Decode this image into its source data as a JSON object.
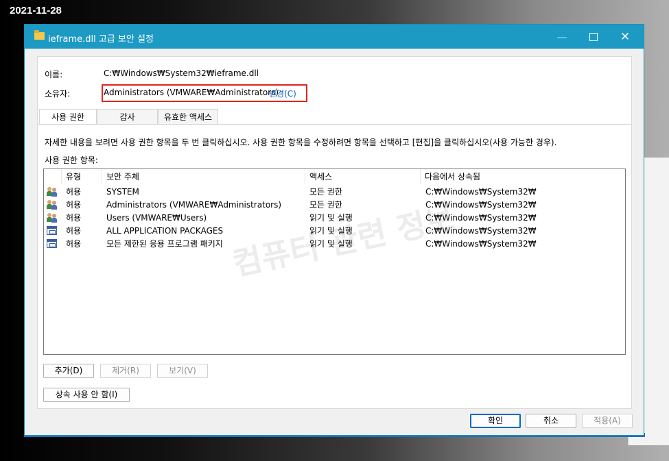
{
  "date": "2021-11-28",
  "window": {
    "title": "ieframe.dll 고급 보안 설정",
    "minimize_label": "—",
    "close_label": "✕"
  },
  "fields": {
    "name_label": "이름:",
    "name_value": "C:₩Windows₩System32₩ieframe.dll",
    "owner_label": "소유자:",
    "owner_value": "Administrators (VMWARE₩Administrators)",
    "owner_change": "변경(C)"
  },
  "tabs": [
    "사용 권한",
    "감사",
    "유효한 액세스"
  ],
  "description": "자세한 내용을 보려면 사용 권한 항목을 두 번 클릭하십시오. 사용 권한 항목을 수정하려면 항목을 선택하고 [편집]을 클릭하십시오(사용 가능한 경우).",
  "list_label": "사용 권한 항목:",
  "columns": [
    "유형",
    "보안 주체",
    "액세스",
    "다음에서 상속됨"
  ],
  "rows": [
    {
      "icon": "users-icon",
      "type": "허용",
      "principal": "SYSTEM",
      "access": "모든 권한",
      "inherited": "C:₩Windows₩System32₩"
    },
    {
      "icon": "users-icon",
      "type": "허용",
      "principal": "Administrators (VMWARE₩Administrators)",
      "access": "모든 권한",
      "inherited": "C:₩Windows₩System32₩"
    },
    {
      "icon": "users-icon",
      "type": "허용",
      "principal": "Users (VMWARE₩Users)",
      "access": "읽기 및 실행",
      "inherited": "C:₩Windows₩System32₩"
    },
    {
      "icon": "package-icon",
      "type": "허용",
      "principal": "ALL APPLICATION PACKAGES",
      "access": "읽기 및 실행",
      "inherited": "C:₩Windows₩System32₩"
    },
    {
      "icon": "package-icon",
      "type": "허용",
      "principal": "모든 제한된 응용 프로그램 패키지",
      "access": "읽기 및 실행",
      "inherited": "C:₩Windows₩System32₩"
    }
  ],
  "buttons": {
    "add": "추가(D)",
    "remove": "제거(R)",
    "view": "보기(V)",
    "disable_inheritance": "상속 사용 안 함(I)",
    "ok": "확인",
    "cancel": "취소",
    "apply": "적용(A)"
  },
  "watermark": "컴퓨터 관련 정보",
  "colors": {
    "titlebar": "#1c9ac4",
    "highlight_border": "#e2231a",
    "link": "#0a5fc4"
  }
}
